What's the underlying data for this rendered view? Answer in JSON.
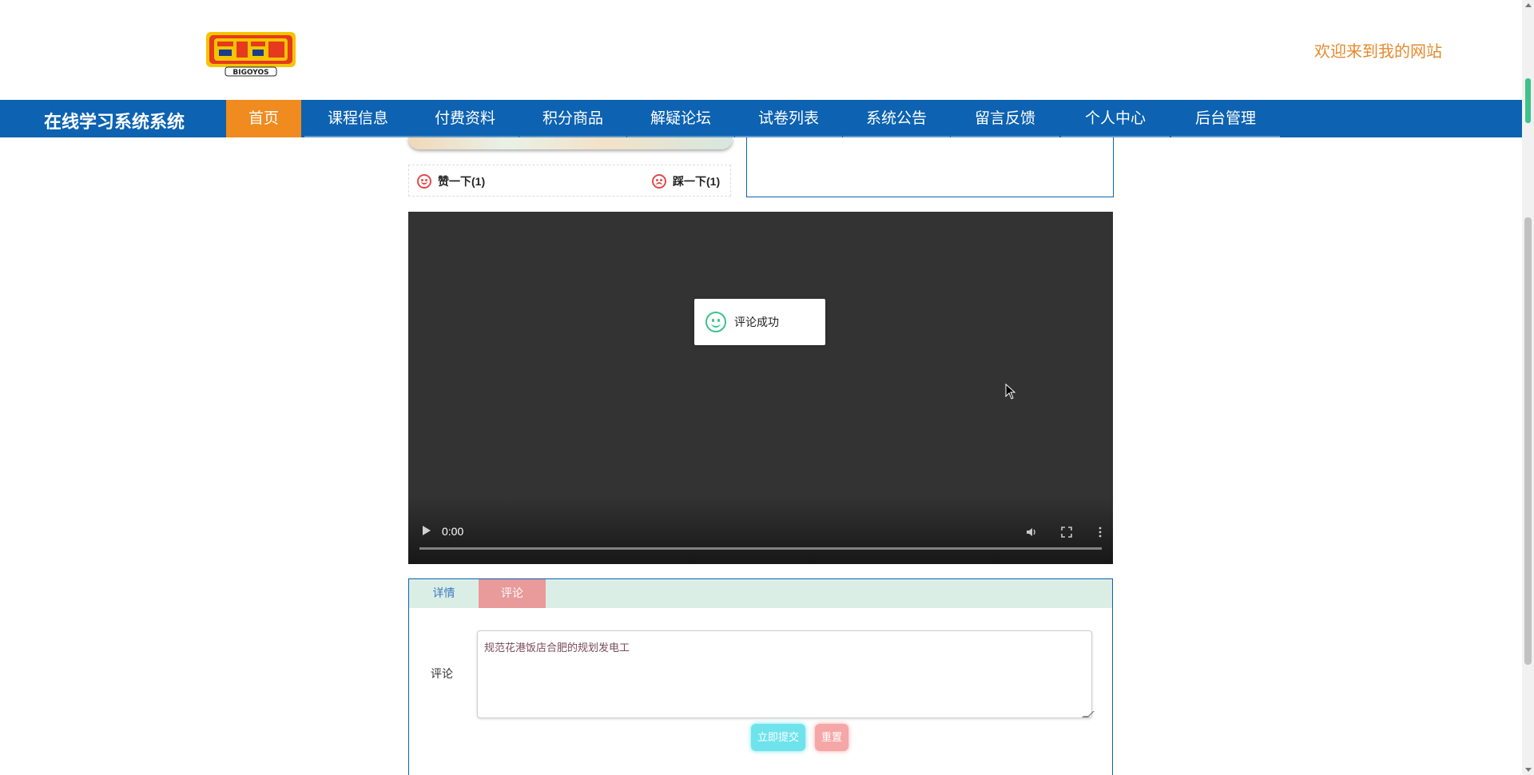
{
  "header": {
    "logo_text": "BIGOYOS",
    "welcome": "欢迎来到我的网站"
  },
  "nav": {
    "brand": "在线学习系统系统",
    "items": [
      {
        "label": "首页",
        "active": true
      },
      {
        "label": "课程信息"
      },
      {
        "label": "付费资料"
      },
      {
        "label": "积分商品"
      },
      {
        "label": "解疑论坛"
      },
      {
        "label": "试卷列表"
      },
      {
        "label": "系统公告"
      },
      {
        "label": "留言反馈"
      },
      {
        "label": "个人中心"
      },
      {
        "label": "后台管理"
      }
    ]
  },
  "vote": {
    "like": "赞一下(1)",
    "dislike": "踩一下(1)"
  },
  "video": {
    "time": "0:00"
  },
  "toast": {
    "message": "评论成功"
  },
  "tabs": {
    "details": "详情",
    "comment": "评论"
  },
  "comment_form": {
    "label": "评论",
    "value": "规范花港饭店合肥的规划发电工",
    "submit": "立即提交",
    "reset": "重置"
  },
  "colors": {
    "nav_bg": "#0d62b1",
    "nav_active": "#f08b1f",
    "welcome": "#e68a2e",
    "submit": "#6fe3ec",
    "reset": "#f5a7a7"
  }
}
